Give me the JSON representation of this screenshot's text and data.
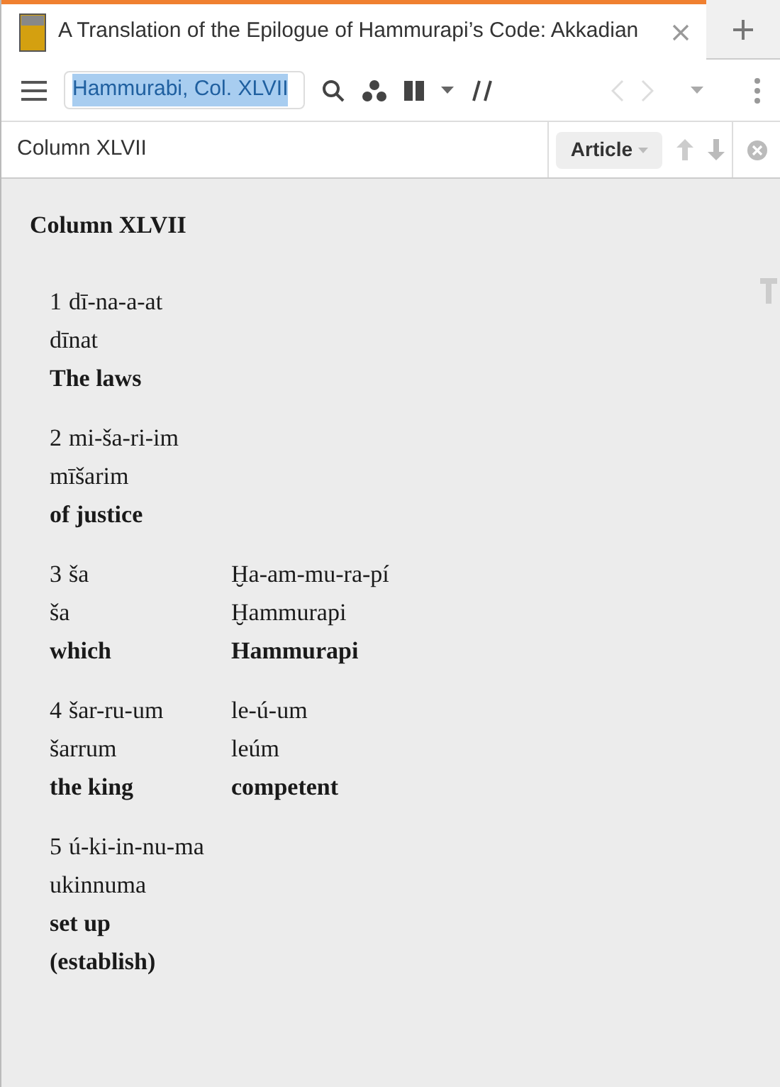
{
  "tab": {
    "title": "A Translation of the Epilogue of Hammurapi’s Code: Akkadian"
  },
  "toolbar": {
    "location": "Hammurabi, Col. XLVII"
  },
  "find_bar": {
    "title": "Column XLVII",
    "mode": "Article"
  },
  "content": {
    "heading": "Column XLVII",
    "rows": [
      [
        {
          "number": "1",
          "translit": "dī-na-a-at",
          "normalized": "dīnat",
          "translation": "The laws"
        }
      ],
      [
        {
          "number": "2",
          "translit": "mi-ša-ri-im",
          "normalized": "mīšarim",
          "translation": "of justice"
        }
      ],
      [
        {
          "number": "3",
          "translit": "ša",
          "normalized": "ša",
          "translation": "which"
        },
        {
          "translit": "Ḫa-am-mu-ra-pí",
          "normalized": "Ḫammurapi",
          "translation": "Hammurapi"
        }
      ],
      [
        {
          "number": "4",
          "translit": "šar-ru-um",
          "normalized": "šarrum",
          "translation": "the king"
        },
        {
          "translit": "le-ú-um",
          "normalized": "leúm",
          "translation": "competent"
        }
      ],
      [
        {
          "number": "5",
          "translit": "ú-ki-in-nu-ma",
          "normalized": "ukinnuma",
          "translation": "set up (establish)"
        }
      ]
    ]
  }
}
